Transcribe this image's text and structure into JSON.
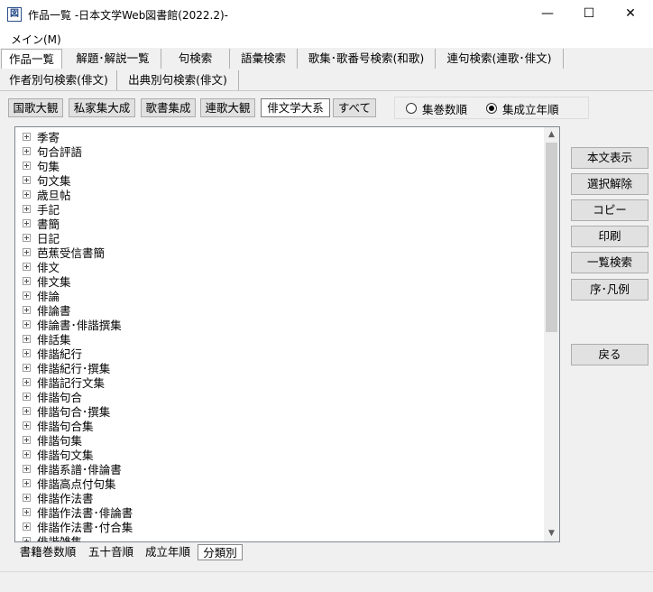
{
  "window": {
    "icon_glyph": "図",
    "title": "作品一覧 -日本文学Web図書館(2022.2)-",
    "minimize_glyph": "—",
    "maximize_glyph": "☐",
    "close_glyph": "✕"
  },
  "menu": {
    "main": "メイン(M)"
  },
  "tabs_row1": [
    "作品一覧",
    "解題･解説一覧",
    "句検索",
    "語彙検索",
    "歌集･歌番号検索(和歌)",
    "連句検索(連歌･俳文)"
  ],
  "tabs_row2": [
    "作者別句検索(俳文)",
    "出典別句検索(俳文)"
  ],
  "collections": [
    "国歌大観",
    "私家集大成",
    "歌書集成",
    "連歌大観",
    "俳文学大系",
    "すべて"
  ],
  "sort_options": {
    "volume": "集巻数順",
    "year": "集成立年順",
    "selected": "year"
  },
  "tree": {
    "items": [
      "季寄",
      "句合評語",
      "句集",
      "句文集",
      "歳旦帖",
      "手記",
      "書簡",
      "日記",
      "芭蕉受信書簡",
      "俳文",
      "俳文集",
      "俳論",
      "俳論書",
      "俳論書･俳諧撰集",
      "俳話集",
      "俳諧紀行",
      "俳諧紀行･撰集",
      "俳諧記行文集",
      "俳諧句合",
      "俳諧句合･撰集",
      "俳諧句合集",
      "俳諧句集",
      "俳諧句文集",
      "俳諧系譜･俳論書",
      "俳諧高点付句集",
      "俳諧作法書",
      "俳諧作法書･俳論書",
      "俳諧作法書･付合集",
      "俳諧雑集"
    ]
  },
  "side_buttons": [
    "本文表示",
    "選択解除",
    "コピー",
    "印刷",
    "一覧検索",
    "序･凡例",
    "戻る"
  ],
  "bottom_tabs": [
    "書籍巻数順",
    "五十音順",
    "成立年順",
    "分類別"
  ],
  "active_bottom_tab": "分類別",
  "scroll_glyphs": {
    "up": "▲",
    "down": "▼"
  }
}
